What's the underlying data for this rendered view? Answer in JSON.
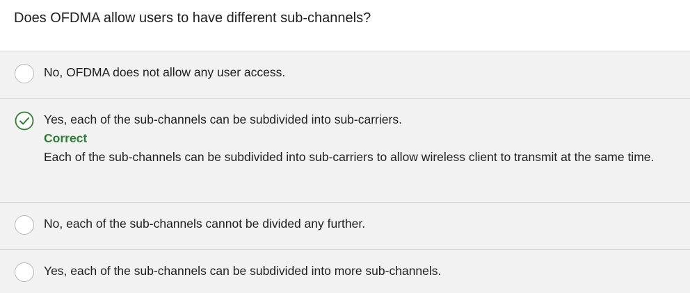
{
  "question": {
    "text": "Does OFDMA allow users to have different sub-channels?"
  },
  "options": [
    {
      "label": "No, OFDMA does not allow any user access.",
      "state": "unselected"
    },
    {
      "label": "Yes, each of the sub-channels can be subdivided into sub-carriers.",
      "state": "correct",
      "icon": "check-circle-icon",
      "feedback_status": "Correct",
      "feedback_explanation": "Each of the sub-channels can be subdivided into sub-carriers to allow wireless client to transmit at the same time."
    },
    {
      "label": "No, each of the sub-channels cannot be divided any further.",
      "state": "unselected"
    },
    {
      "label": "Yes, each of the sub-channels can be subdivided into more sub-channels.",
      "state": "unselected"
    }
  ],
  "colors": {
    "correct": "#2e7d32",
    "option_background": "#f2f2f2",
    "divider": "#d6d6d6"
  }
}
